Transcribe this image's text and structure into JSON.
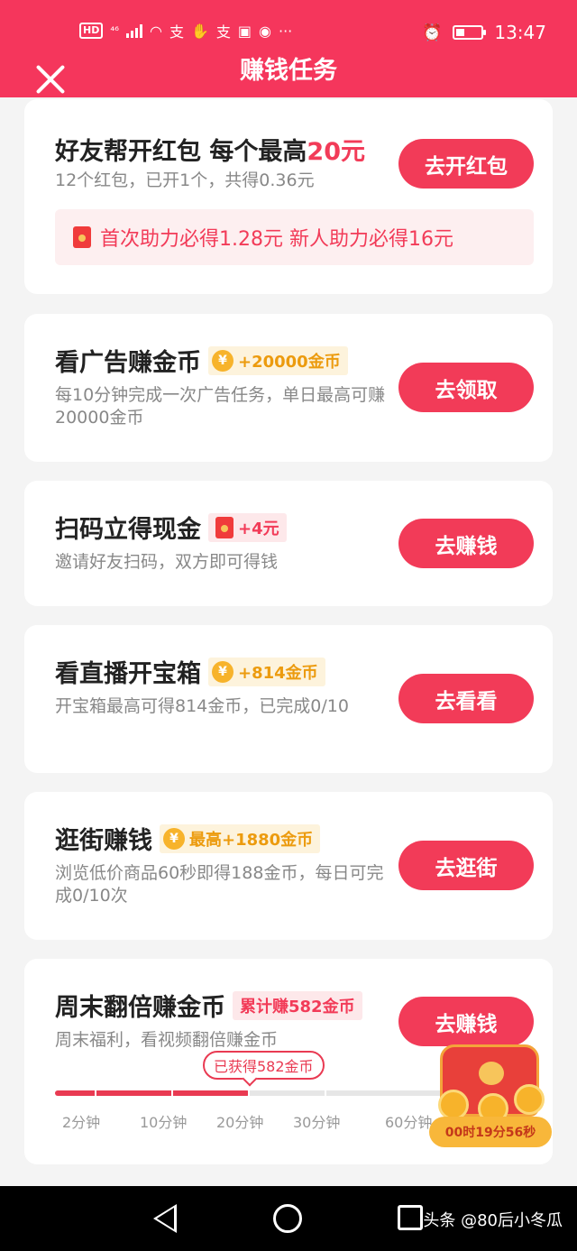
{
  "status_bar": {
    "left_badges": [
      "HD",
      "⁴⁶"
    ],
    "time": "13:47"
  },
  "header": {
    "title": "赚钱任务"
  },
  "cards": {
    "friend_help": {
      "title_prefix": "好友帮开红包 每个最高",
      "title_highlight": "20元",
      "desc": "12个红包，已开1个，共得0.36元",
      "button": "去开红包",
      "notice": "首次助力必得1.28元 新人助力必得16元"
    },
    "ad": {
      "title": "看广告赚金币",
      "badge": "+20000金币",
      "desc": "每10分钟完成一次广告任务，单日最高可赚20000金币",
      "button": "去领取"
    },
    "scan": {
      "title": "扫码立得现金",
      "badge": "+4元",
      "desc": "邀请好友扫码，双方即可得钱",
      "button": "去赚钱"
    },
    "live": {
      "title": "看直播开宝箱",
      "badge": "+814金币",
      "desc": "开宝箱最高可得814金币，已完成0/10",
      "button": "去看看"
    },
    "shop": {
      "title": "逛街赚钱",
      "badge": "最高+1880金币",
      "desc": "浏览低价商品60秒即得188金币，每日可完成0/10次",
      "button": "去逛街"
    },
    "weekend": {
      "title": "周末翻倍赚金币",
      "badge": "累计赚582金币",
      "desc": "周末福利，看视频翻倍赚金币",
      "button": "去赚钱",
      "earned_tip": "已获得582金币",
      "progress": 0.49,
      "ticks": [
        "2分钟",
        "10分钟",
        "20分钟",
        "30分钟",
        "60分钟"
      ]
    }
  },
  "chest": {
    "timer": "00时19分56秒"
  },
  "watermark": "头条 @80后小冬瓜",
  "colors": {
    "primary": "#f5365c",
    "gold": "#ec9b0e"
  }
}
